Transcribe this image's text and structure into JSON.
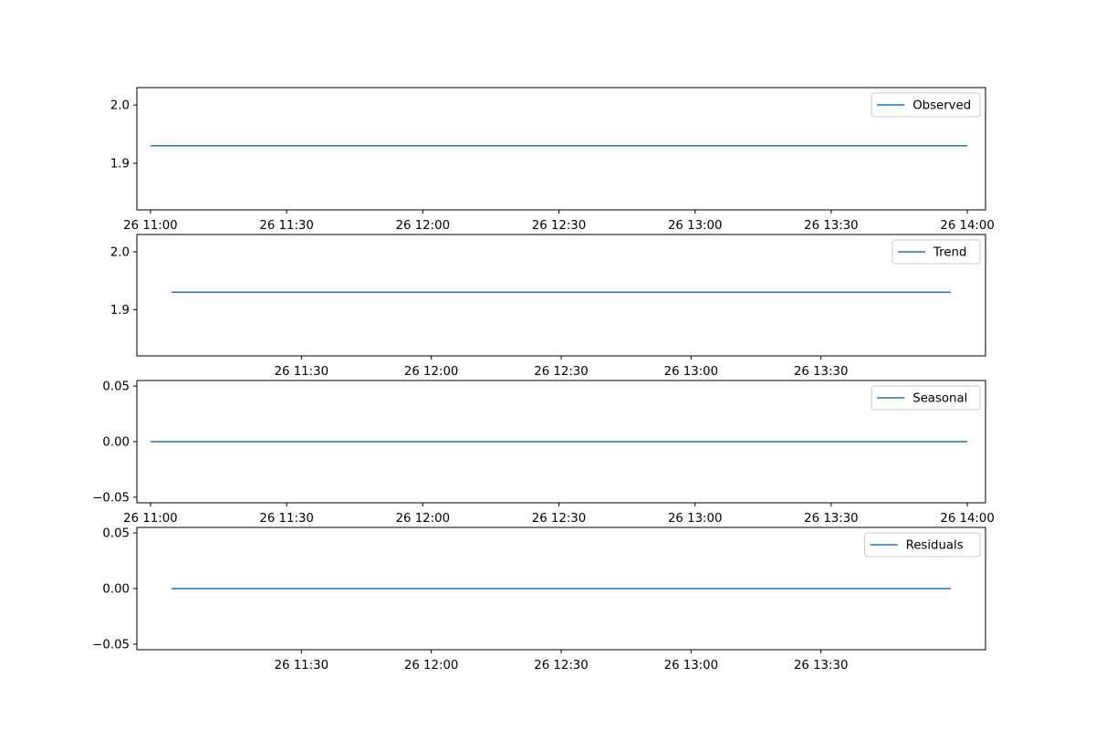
{
  "chart_data": [
    {
      "type": "line",
      "x": [
        "26 11:00",
        "26 14:00"
      ],
      "series": [
        {
          "name": "Observed",
          "values": [
            1.93,
            1.93
          ],
          "color": "#1f77b4"
        }
      ],
      "ylim": [
        1.82,
        2.03
      ],
      "yticks": [
        {
          "value": 1.9,
          "label": "1.9"
        },
        {
          "value": 2.0,
          "label": "2.0"
        }
      ],
      "xlim": [
        "26 10:57",
        "26 14:04"
      ],
      "xticks": [
        "26 11:00",
        "26 11:30",
        "26 12:00",
        "26 12:30",
        "26 13:00",
        "26 13:30",
        "26 14:00"
      ],
      "legend": "top-right",
      "grid": false
    },
    {
      "type": "line",
      "x": [
        "26 11:00",
        "26 14:00"
      ],
      "series": [
        {
          "name": "Trend",
          "values": [
            1.93,
            1.93
          ],
          "color": "#1f77b4"
        }
      ],
      "ylim": [
        1.82,
        2.03
      ],
      "yticks": [
        {
          "value": 1.9,
          "label": "1.9"
        },
        {
          "value": 2.0,
          "label": "2.0"
        }
      ],
      "xlim": [
        "26 10:52",
        "26 14:08"
      ],
      "xticks": [
        "26 11:30",
        "26 12:00",
        "26 12:30",
        "26 13:00",
        "26 13:30"
      ],
      "legend": "top-right",
      "grid": false
    },
    {
      "type": "line",
      "x": [
        "26 11:00",
        "26 14:00"
      ],
      "series": [
        {
          "name": "Seasonal",
          "values": [
            0.0,
            0.0
          ],
          "color": "#1f77b4"
        }
      ],
      "ylim": [
        -0.055,
        0.055
      ],
      "yticks": [
        {
          "value": -0.05,
          "label": "−0.05"
        },
        {
          "value": 0.0,
          "label": "0.00"
        },
        {
          "value": 0.05,
          "label": "0.05"
        }
      ],
      "xlim": [
        "26 10:57",
        "26 14:04"
      ],
      "xticks": [
        "26 11:00",
        "26 11:30",
        "26 12:00",
        "26 12:30",
        "26 13:00",
        "26 13:30",
        "26 14:00"
      ],
      "legend": "top-right",
      "grid": false
    },
    {
      "type": "line",
      "x": [
        "26 11:00",
        "26 14:00"
      ],
      "series": [
        {
          "name": "Residuals",
          "values": [
            0.0,
            0.0
          ],
          "color": "#1f77b4"
        }
      ],
      "ylim": [
        -0.055,
        0.055
      ],
      "yticks": [
        {
          "value": -0.05,
          "label": "−0.05"
        },
        {
          "value": 0.0,
          "label": "0.00"
        },
        {
          "value": 0.05,
          "label": "0.05"
        }
      ],
      "xlim": [
        "26 10:52",
        "26 14:08"
      ],
      "xticks": [
        "26 11:30",
        "26 12:00",
        "26 12:30",
        "26 13:00",
        "26 13:30"
      ],
      "legend": "top-right",
      "grid": false
    }
  ]
}
